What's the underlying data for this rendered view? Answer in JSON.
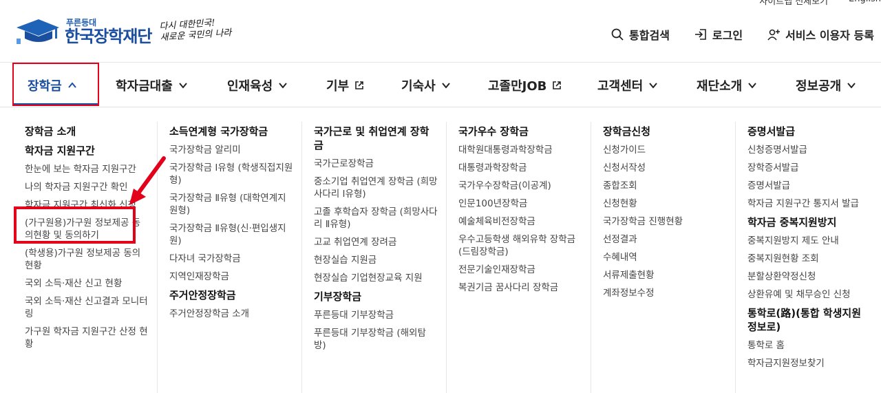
{
  "util": {
    "sitemap": "사이트맵 전체보기",
    "english": "English"
  },
  "header": {
    "logo_small": "푸른등대",
    "logo_big": "한국장학재단",
    "slogan_line1": "다시 대한민국!",
    "slogan_line2": "새로운 국민의 나라",
    "links": [
      {
        "label": "통합검색",
        "icon": "search-icon"
      },
      {
        "label": "로그인",
        "icon": "login-icon"
      },
      {
        "label": "서비스 이용자 등록",
        "icon": "user-add-icon"
      }
    ]
  },
  "gnb": [
    {
      "label": "장학금",
      "icon": "chevron-up-icon"
    },
    {
      "label": "학자금대출",
      "icon": "chevron-down-icon"
    },
    {
      "label": "인재육성",
      "icon": "chevron-down-icon"
    },
    {
      "label": "기부",
      "icon": "external-link-icon"
    },
    {
      "label": "기숙사",
      "icon": "chevron-down-icon"
    },
    {
      "label": "고졸만JOB",
      "icon": "external-link-icon"
    },
    {
      "label": "고객센터",
      "icon": "chevron-down-icon"
    },
    {
      "label": "재단소개",
      "icon": "chevron-down-icon"
    },
    {
      "label": "정보공개",
      "icon": "chevron-down-icon"
    }
  ],
  "menu": {
    "col1": {
      "cat1": "장학금 소개",
      "cat2": "학자금 지원구간",
      "items": [
        "한눈에 보는 학자금 지원구간",
        "나의 학자금 지원구간 확인",
        "학자금 지원구간 최신화 신청",
        "(가구원용)가구원 정보제공 동의현황 및 동의하기",
        "(학생용)가구원 정보제공 동의현황",
        "국외 소득·재산 신고 현황",
        "국외 소득·재산 신고결과 모니터링",
        "가구원 학자금 지원구간 산정 현황"
      ]
    },
    "col2": {
      "cat1": "소득연계형 국가장학금",
      "items1": [
        "국가장학금 알리미",
        "국가장학금 Ⅰ유형 (학생직접지원형)",
        "국가장학금 Ⅱ유형 (대학연계지원형)",
        "국가장학금 Ⅱ유형(신·편입생지원)",
        "다자녀 국가장학금",
        "지역인재장학금"
      ],
      "cat2": "주거안정장학금",
      "items2": [
        "주거안정장학금 소개"
      ]
    },
    "col3": {
      "cat1": "국가근로 및 취업연계 장학금",
      "items1": [
        "국가근로장학금",
        "중소기업 취업연계 장학금 (희망사다리 Ⅰ유형)",
        "고졸 후학습자 장학금 (희망사다리 Ⅱ유형)",
        "고교 취업연계 장려금",
        "현장실습 지원금",
        "현장실습 기업현장교육 지원"
      ],
      "cat2": "기부장학금",
      "items2": [
        "푸른등대 기부장학금",
        "푸른등대 기부장학금 (해외탐방)"
      ]
    },
    "col4": {
      "cat1": "국가우수 장학금",
      "items": [
        "대학원대통령과학장학금",
        "대통령과학장학금",
        "국가우수장학금(이공계)",
        "인문100년장학금",
        "예술체육비전장학금",
        "우수고등학생 해외유학 장학금(드림장학금)",
        "전문기술인재장학금",
        "복권기금 꿈사다리 장학금"
      ]
    },
    "col5": {
      "cat1": "장학금신청",
      "items": [
        "신청가이드",
        "신청서작성",
        "종합조회",
        "신청현황",
        "국가장학금 진행현황",
        "선정결과",
        "수혜내역",
        "서류제출현황",
        "계좌정보수정"
      ]
    },
    "col6": {
      "cat1": "증명서발급",
      "items1": [
        "신청증명서발급",
        "장학증서발급",
        "증명서발급",
        "학자금 지원구간 통지서 발급"
      ],
      "cat2": "학자금 중복지원방지",
      "items2": [
        "중복지원방지 제도 안내",
        "중복지원현황 조회",
        "분할상환약정신청",
        "상환유예 및 채무승인 신청"
      ],
      "cat3": "통학로(路)(통합 학생지원 정보로)",
      "items3": [
        "통학로 홈",
        "학자금지원정보찾기"
      ]
    }
  },
  "colors": {
    "brand": "#1a4fa0",
    "highlight": "#e3001b"
  }
}
